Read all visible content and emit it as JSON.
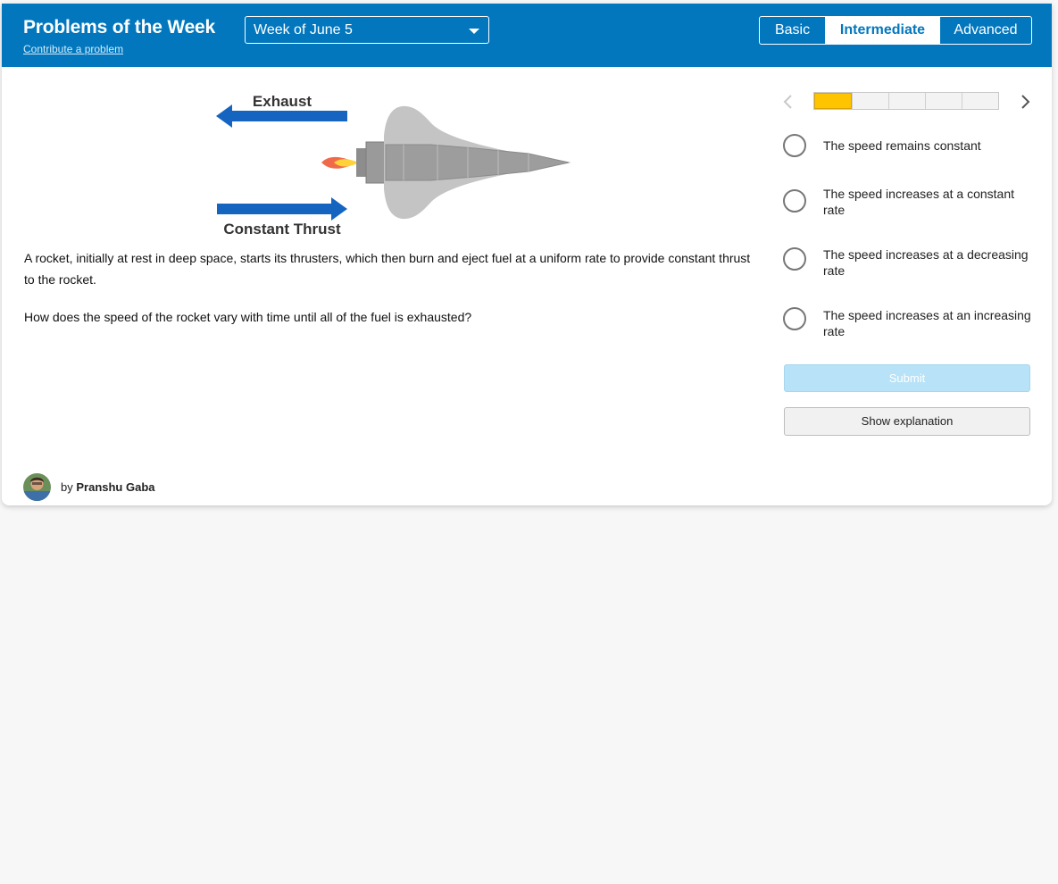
{
  "header": {
    "title": "Problems of the Week",
    "contribute_link": "Contribute a problem",
    "week_select": {
      "selected": "Week of June 5"
    },
    "levels": [
      {
        "label": "Basic",
        "active": false
      },
      {
        "label": "Intermediate",
        "active": true
      },
      {
        "label": "Advanced",
        "active": false
      }
    ]
  },
  "diagram": {
    "exhaust_label": "Exhaust",
    "thrust_label": "Constant Thrust"
  },
  "problem": {
    "statement": "A rocket, initially at rest in deep space, starts its thrusters, which then burn and eject fuel at a uniform rate to provide constant thrust to the rocket.",
    "question": "How does the speed of the rocket vary with time until all of the fuel is exhausted?"
  },
  "progress": {
    "current": 1,
    "total": 5
  },
  "options": [
    "The speed remains constant",
    "The speed increases at a constant rate",
    "The speed increases at a decreasing rate",
    "The speed increases at an increasing rate"
  ],
  "buttons": {
    "submit": "Submit",
    "explanation": "Show explanation"
  },
  "author": {
    "prefix": "by",
    "name": "Pranshu Gaba"
  },
  "colors": {
    "header_bg": "#0277bd",
    "arrow": "#1565c0",
    "progress_fill": "#ffc400",
    "submit_disabled": "#b8e2f7"
  },
  "icons": [
    "chevron-left-icon",
    "chevron-right-icon",
    "caret-down-icon",
    "rocket-illustration",
    "avatar"
  ]
}
